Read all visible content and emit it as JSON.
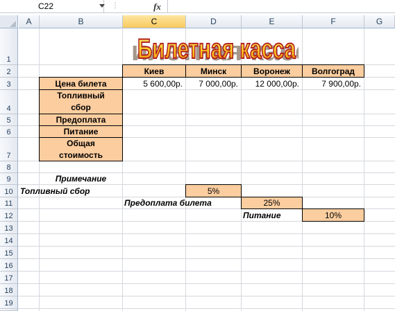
{
  "formula_bar": {
    "name_box": "C22",
    "fx_label": "fx",
    "formula": "",
    "dots": "⋮"
  },
  "columns": [
    "A",
    "B",
    "C",
    "D",
    "E",
    "F",
    "G"
  ],
  "rows": [
    "1",
    "2",
    "3",
    "4",
    "5",
    "6",
    "7",
    "8",
    "9",
    "10",
    "11",
    "12",
    "13",
    "14",
    "15",
    "16",
    "17",
    "18",
    "19"
  ],
  "selected_column": "C",
  "title": "Билетная касса",
  "cities": [
    "Киев",
    "Минск",
    "Воронеж",
    "Волгоград"
  ],
  "row_labels": [
    "Цена билета",
    "Топливный сбор",
    "Предоплата",
    "Питание",
    "Общая стоимость"
  ],
  "prices": [
    "5 600,00р.",
    "7 000,00р.",
    "12 000,00р.",
    "7 900,00р."
  ],
  "notes": {
    "heading": "Примечание",
    "fuel_label": "Топливный сбор",
    "fuel_value": "5%",
    "prepay_label": "Предоплата билета",
    "prepay_value": "25%",
    "food_label": "Питание",
    "food_value": "10%"
  },
  "colors": {
    "accent": "#fbcd9f",
    "title_fill": "#ffd43a",
    "title_stroke": "#c0392b"
  }
}
